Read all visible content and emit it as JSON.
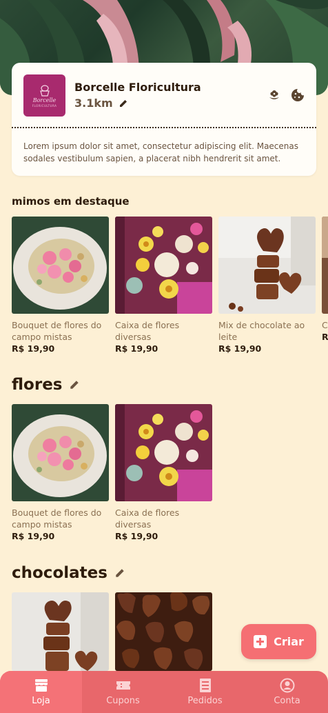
{
  "store": {
    "name": "Borcelle Floricultura",
    "distance": "3.1km",
    "logo_text": "Borcelle",
    "logo_sub": "FLORICULTURA",
    "description": "Lorem ipsum dolor sit amet, consectetur adipiscing elit. Maecenas sodales vestibulum sapien, a placerat nibh hendrerit sit amet."
  },
  "featured": {
    "title": "mimos em destaque",
    "items": [
      {
        "name": "Bouquet de flores do campo mistas",
        "price": "R$ 19,90"
      },
      {
        "name": "Caixa de flores diversas",
        "price": "R$ 19,90"
      },
      {
        "name": "Mix de chocolate ao leite",
        "price": "R$ 19,90"
      },
      {
        "name": "C fo",
        "price": "R"
      }
    ]
  },
  "flowers": {
    "title": "flores",
    "items": [
      {
        "name": "Bouquet de flores do campo mistas",
        "price": "R$ 19,90"
      },
      {
        "name": "Caixa de flores diversas",
        "price": "R$ 19,90"
      }
    ]
  },
  "chocolates": {
    "title": "chocolates"
  },
  "fab": {
    "label": "Criar"
  },
  "nav": {
    "items": [
      {
        "label": "Loja",
        "icon": "store-icon",
        "active": true
      },
      {
        "label": "Cupons",
        "icon": "ticket-icon",
        "active": false
      },
      {
        "label": "Pedidos",
        "icon": "receipt-icon",
        "active": false
      },
      {
        "label": "Conta",
        "icon": "account-icon",
        "active": false
      }
    ]
  },
  "colors": {
    "background": "#fdf0d5",
    "accent": "#f56f73",
    "nav": "#e8676b",
    "logo": "#a82a6e"
  }
}
